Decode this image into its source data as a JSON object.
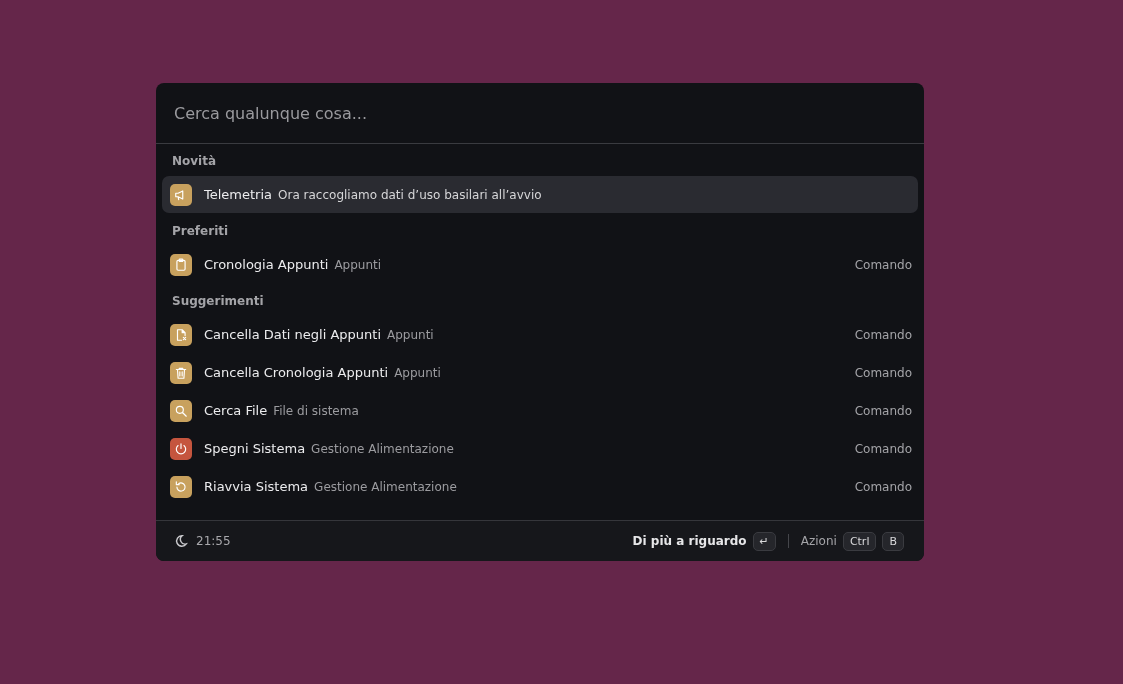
{
  "search": {
    "placeholder": "Cerca qualunque cosa..."
  },
  "sections": [
    {
      "title": "Novità",
      "items": [
        {
          "kind": "megaphone",
          "color": "#c8a15e",
          "title": "Telemetria",
          "subtitle": "Ora raccogliamo dati d’uso basilari all’avvio",
          "selected": true
        }
      ]
    },
    {
      "title": "Preferiti",
      "items": [
        {
          "kind": "clipboard",
          "color": "#c8a15e",
          "title": "Cronologia Appunti",
          "subtitle": "Appunti",
          "accessory": "Comando",
          "selected": false
        }
      ]
    },
    {
      "title": "Suggerimenti",
      "items": [
        {
          "kind": "file-x",
          "color": "#c8a15e",
          "title": "Cancella Dati negli Appunti",
          "subtitle": "Appunti",
          "accessory": "Comando",
          "selected": false
        },
        {
          "kind": "trash",
          "color": "#c8a15e",
          "title": "Cancella Cronologia Appunti",
          "subtitle": "Appunti",
          "accessory": "Comando",
          "selected": false
        },
        {
          "kind": "search",
          "color": "#c8a15e",
          "title": "Cerca File",
          "subtitle": "File di sistema",
          "accessory": "Comando",
          "selected": false
        },
        {
          "kind": "power",
          "color": "#c5553e",
          "title": "Spegni Sistema",
          "subtitle": "Gestione Alimentazione",
          "accessory": "Comando",
          "selected": false
        },
        {
          "kind": "restart",
          "color": "#c8a15e",
          "title": "Riavvia Sistema",
          "subtitle": "Gestione Alimentazione",
          "accessory": "Comando",
          "selected": false
        }
      ]
    }
  ],
  "footer": {
    "time": "21:55",
    "primary_action": "Di più a riguardo",
    "primary_key": "↵",
    "actions_label": "Azioni",
    "action_keys": [
      "Ctrl",
      "B"
    ]
  }
}
